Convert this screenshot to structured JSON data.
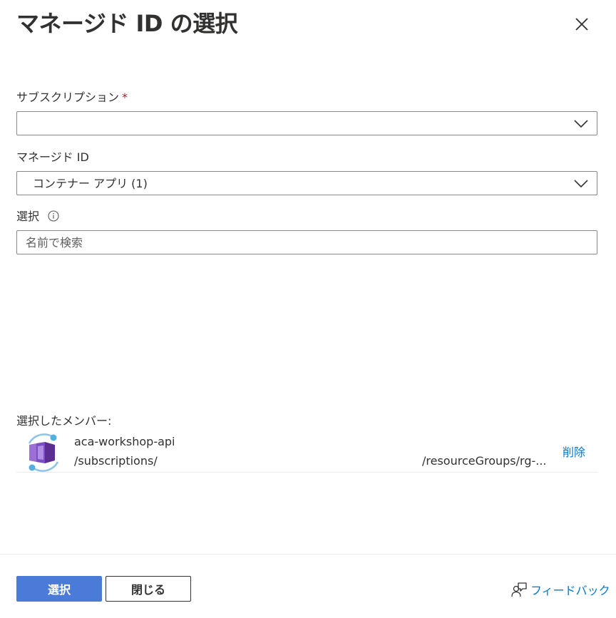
{
  "panel": {
    "title": "マネージド ID の選択",
    "close_icon": "close-icon"
  },
  "subscription": {
    "label": "サブスクリプション",
    "required_marker": "*",
    "value": ""
  },
  "managed_identity": {
    "label": "マネージド ID",
    "value": "コンテナー アプリ (1)"
  },
  "select": {
    "label": "選択",
    "info_icon": "info-icon",
    "search_placeholder": "名前で検索"
  },
  "selected_members": {
    "label": "選択したメンバー:",
    "items": [
      {
        "icon": "container-app-icon",
        "name": "aca-workshop-api",
        "path_left": "/subscriptions/",
        "path_right": "/resourceGroups/rg-...",
        "remove_label": "削除"
      }
    ]
  },
  "footer": {
    "select_button": "選択",
    "close_button": "閉じる",
    "feedback_label": "フィードバック",
    "feedback_icon": "feedback-icon"
  },
  "colors": {
    "primary": "#4a7bd8",
    "link": "#0078d4",
    "required": "#a4262c",
    "text": "#323130"
  }
}
